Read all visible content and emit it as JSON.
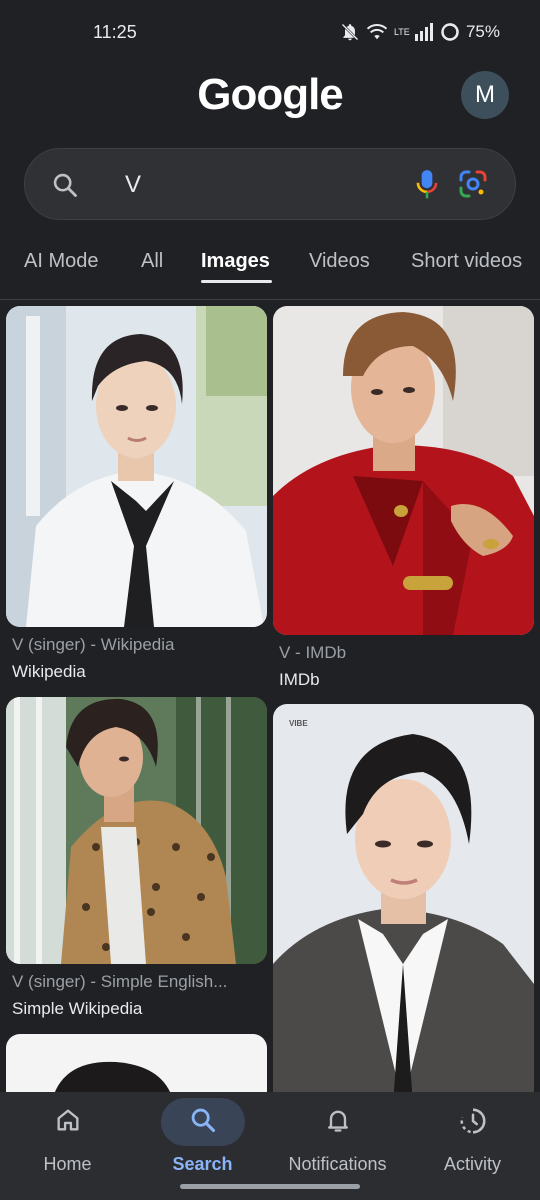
{
  "status_bar": {
    "time": "11:25",
    "network": "LTE",
    "battery": "75%",
    "icons": [
      "mute-icon",
      "wifi-icon",
      "lte-icon",
      "signal-icon",
      "battery-icon"
    ]
  },
  "header": {
    "logo": "Google",
    "avatar_letter": "M"
  },
  "search": {
    "query": "V",
    "icons": [
      "search-icon",
      "mic-icon",
      "lens-icon"
    ]
  },
  "tabs": [
    {
      "label": "AI Mode",
      "active": false
    },
    {
      "label": "All",
      "active": false
    },
    {
      "label": "Images",
      "active": true
    },
    {
      "label": "Videos",
      "active": false
    },
    {
      "label": "Short videos",
      "active": false
    }
  ],
  "results": [
    {
      "title": "V (singer) - Wikipedia",
      "source": "Wikipedia"
    },
    {
      "title": "V - IMDb",
      "source": "IMDb"
    },
    {
      "title": "V (singer) - Simple English...",
      "source": "Simple Wikipedia"
    },
    {
      "image_text": "VIBE"
    }
  ],
  "bottom_nav": [
    {
      "label": "Home",
      "icon": "home-icon",
      "active": false
    },
    {
      "label": "Search",
      "icon": "search-icon",
      "active": true
    },
    {
      "label": "Notifications",
      "icon": "bell-icon",
      "active": false
    },
    {
      "label": "Activity",
      "icon": "activity-icon",
      "active": false
    }
  ],
  "colors": {
    "background": "#202124",
    "accent": "#8ab4f8",
    "nav_active_pill": "#394457"
  }
}
